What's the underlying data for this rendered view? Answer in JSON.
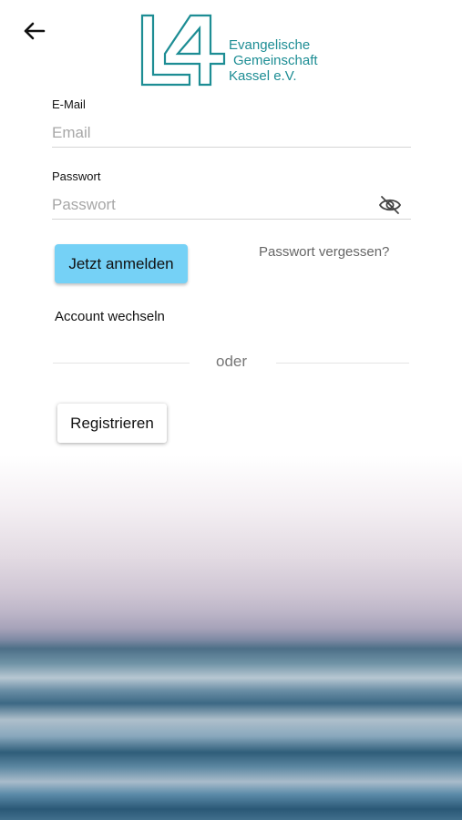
{
  "header": {
    "back_icon": "arrow-left-icon",
    "logo": {
      "mark_text": "L4",
      "lines": [
        "Evangelische",
        "Gemeinschaft",
        "Kassel e.V."
      ],
      "color": "#1d8d94"
    }
  },
  "form": {
    "email": {
      "label": "E-Mail",
      "placeholder": "Email",
      "value": ""
    },
    "password": {
      "label": "Passwort",
      "placeholder": "Passwort",
      "value": "",
      "visibility_icon": "eye-off-icon"
    },
    "login_button": "Jetzt anmelden",
    "forgot_password": "Passwort vergessen?",
    "switch_account": "Account wechseln",
    "divider": "oder",
    "register_button": "Registrieren"
  },
  "colors": {
    "primary_button": "#75d1f6",
    "logo": "#1d8d94"
  }
}
